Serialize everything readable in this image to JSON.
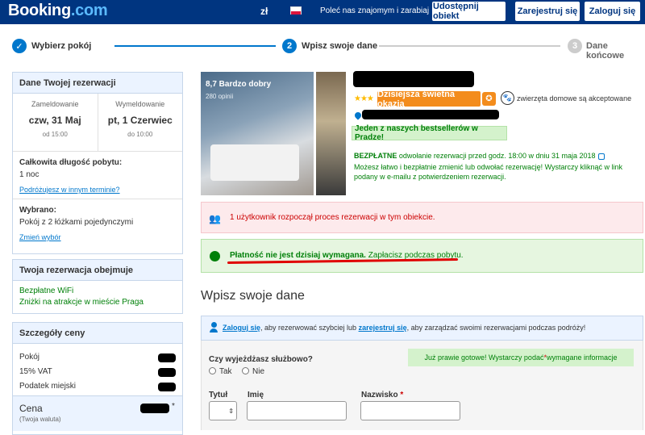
{
  "header": {
    "logo_main": "Booking",
    "logo_dot": ".com",
    "currency": "zł",
    "refer": "Poleć nas znajomym i zarabiaj",
    "list_property": "Udostępnij obiekt",
    "register": "Zarejestruj się",
    "login": "Zaloguj się"
  },
  "stepper": {
    "step1": {
      "label": "Wybierz pokój",
      "icon": "✓"
    },
    "step2": {
      "label": "Wpisz swoje dane",
      "number": "2"
    },
    "step3": {
      "label": "Dane końcowe",
      "number": "3"
    },
    "colors": {
      "active": "#0077cc",
      "inactive": "#cccccc"
    }
  },
  "booking_details": {
    "title": "Dane Twojej rezerwacji",
    "checkin_label": "Zameldowanie",
    "checkin_date": "czw, 31 Maj",
    "checkin_time": "od 15:00",
    "checkout_label": "Wymeldowanie",
    "checkout_date": "pt, 1 Czerwiec",
    "checkout_time": "do 10:00",
    "stay_length_label": "Całkowita długość pobytu:",
    "stay_length_value": "1 noc",
    "change_dates_link": "Podróżujesz w innym terminie?",
    "selected_label": "Wybrano:",
    "selected_value": "Pokój z 2 łóżkami pojedynczymi",
    "change_selection_link": "Zmień wybór"
  },
  "includes": {
    "title": "Twoja rezerwacja obejmuje",
    "items": [
      "Bezpłatne WiFi",
      "Zniżki na atrakcje w mieście Praga"
    ]
  },
  "price": {
    "title": "Szczegóły ceny",
    "rows": [
      "Pokój",
      "15% VAT",
      "Podatek miejski"
    ],
    "total_label": "Cena",
    "total_sub": "(Twoja waluta)",
    "total_star": "*"
  },
  "hotel": {
    "photo_rating": "8,7 Bardzo dobry",
    "photo_rating_sub": "280 opinii",
    "stars": "★★★",
    "deal_badge": "Dzisiejsza świetna okazja",
    "pets_text": "zwierzęta domowe są akceptowane",
    "bestseller": "Jeden z naszych bestsellerów w Pradze!",
    "cancel_bold": "BEZPŁATNE",
    "cancel_mid": " odwołanie rezerwacji ",
    "cancel_tail": "przed godz. 18:00 w dniu 31 maja 2018",
    "cancel_detail": "Możesz łatwo i bezpłatnie zmienić lub odwołać rezerwację! Wystarczy kliknąć w link podany w e-mailu z potwierdzeniem rezerwacji.",
    "accent_colors": {
      "deal": "#f38c1c",
      "green": "#008009",
      "red": "#cc0000"
    }
  },
  "alerts": {
    "users_booking": "1 użytkownik rozpoczął proces rezerwacji w tym obiekcie.",
    "pay_bold": "Płatność nie jest dzisiaj wymagana.",
    "pay_rest": " Zapłacisz podczas pobytu."
  },
  "form": {
    "title": "Wpisz swoje dane",
    "login_link": "Zaloguj się",
    "login_mid": ", aby rezerwować szybciej lub ",
    "register_link": "zarejestruj się",
    "login_tail": ", aby zarządzać swoimi rezerwacjami podczas podróży!",
    "business_question": "Czy wyjeżdżasz służbowo?",
    "yes": "Tak",
    "no": "Nie",
    "almost_pre": "Już prawie gotowe! Wystarczy podać ",
    "almost_star": "*",
    "almost_post": " wymagane informacje",
    "title_label": "Tytuł",
    "first_name_label": "Imię",
    "last_name_label": "Nazwisko",
    "last_name_star": "*"
  }
}
